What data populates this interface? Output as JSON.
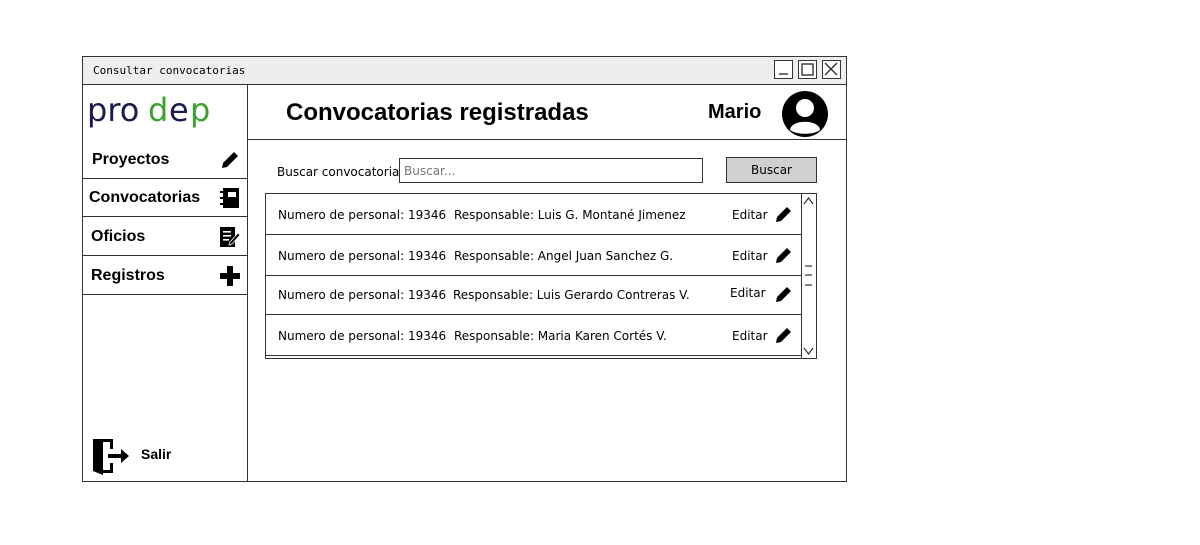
{
  "window": {
    "title": "Consultar convocatorias"
  },
  "sidebar": {
    "logo_text": "prodep",
    "items": [
      {
        "label": "Proyectos",
        "icon": "pencil-icon"
      },
      {
        "label": "Convocatorias",
        "icon": "notebook-icon"
      },
      {
        "label": "Oficios",
        "icon": "document-edit-icon"
      },
      {
        "label": "Registros",
        "icon": "plus-icon"
      }
    ],
    "logout_label": "Salir"
  },
  "header": {
    "title": "Convocatorias registradas",
    "user_name": "Mario"
  },
  "search": {
    "label": "Buscar convocatoria:",
    "placeholder": "Buscar...",
    "button_label": "Buscar"
  },
  "list": {
    "rows": [
      {
        "numero": "Numero de personal: 19346",
        "responsable": "Responsable: Luis G. Montané Jimenez",
        "edit_label": "Editar"
      },
      {
        "numero": "Numero de personal: 19346",
        "responsable": "Responsable: Angel Juan Sanchez G.",
        "edit_label": "Editar"
      },
      {
        "numero": "Numero de personal: 19346",
        "responsable": "Responsable: Luis Gerardo Contreras V.",
        "edit_label": "Editar"
      },
      {
        "numero": "Numero de personal: 19346",
        "responsable": "Responsable: Maria Karen Cortés V.",
        "edit_label": "Editar"
      }
    ]
  },
  "colors": {
    "logo_dark": "#1a1a4e",
    "logo_green": "#3aa12e",
    "button_bg": "#d0d0d0",
    "titlebar_bg": "#eeeeee"
  }
}
